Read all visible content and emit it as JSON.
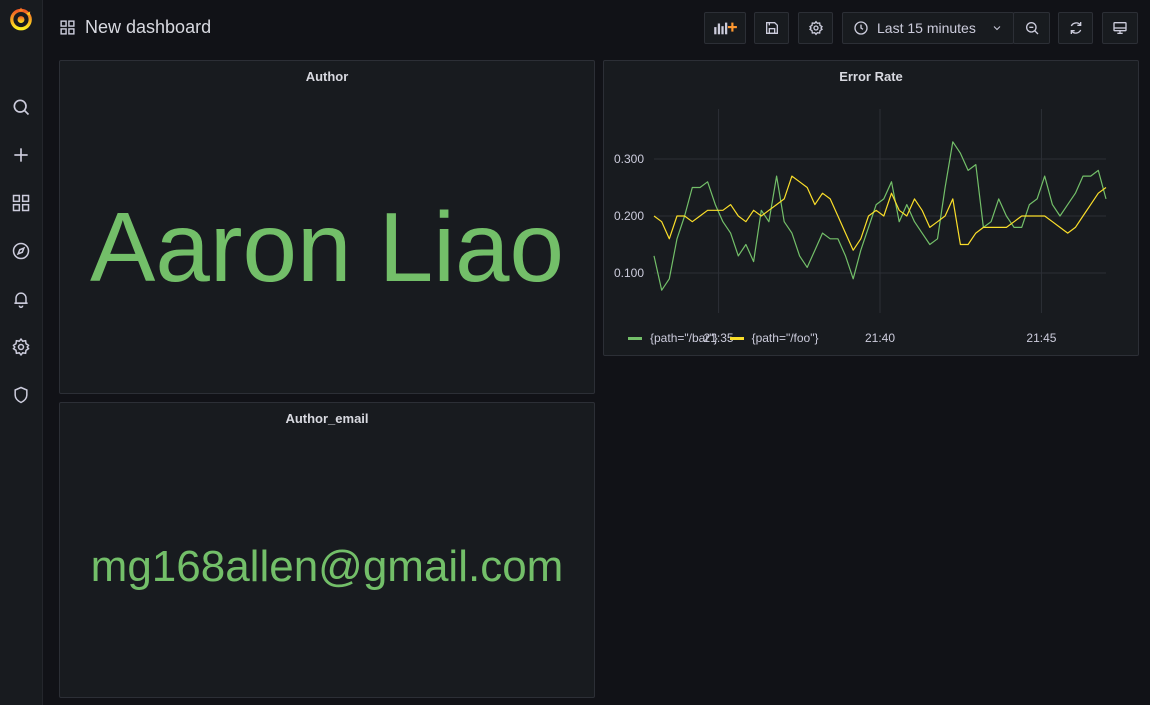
{
  "header": {
    "title": "New dashboard",
    "time_range": "Last 15 minutes"
  },
  "sidebar": {
    "icons": [
      "grafana-logo-icon",
      "search-icon",
      "plus-icon",
      "dashboards-icon",
      "explore-icon",
      "alert-bell-icon",
      "settings-gear-icon",
      "shield-icon"
    ]
  },
  "panels": {
    "author": {
      "title": "Author",
      "value": "Aaron Liao"
    },
    "author_email": {
      "title": "Author_email",
      "value": "mg168allen@gmail.com"
    },
    "error_rate": {
      "title": "Error Rate"
    }
  },
  "colors": {
    "stat": "#73bf69",
    "bar": "#73bf69",
    "foo": "#fade2a",
    "accent": "#f55f3e"
  },
  "chart_data": {
    "type": "line",
    "title": "Error Rate",
    "xlabel": "",
    "ylabel": "",
    "x_ticks": [
      "21:35",
      "21:40",
      "21:45"
    ],
    "y_ticks": [
      "0.100",
      "0.200",
      "0.300"
    ],
    "ylim": [
      0.03,
      0.37
    ],
    "x_range_minutes": [
      21.3,
      22.7
    ],
    "grid": true,
    "legend_position": "bottom-left",
    "series": [
      {
        "name": "{path=\"/bar\"}",
        "color": "#73bf69",
        "values": [
          0.13,
          0.07,
          0.09,
          0.16,
          0.2,
          0.25,
          0.25,
          0.26,
          0.22,
          0.19,
          0.17,
          0.13,
          0.15,
          0.12,
          0.21,
          0.19,
          0.27,
          0.19,
          0.17,
          0.13,
          0.11,
          0.14,
          0.17,
          0.16,
          0.16,
          0.13,
          0.09,
          0.14,
          0.18,
          0.22,
          0.23,
          0.26,
          0.19,
          0.22,
          0.19,
          0.17,
          0.15,
          0.16,
          0.25,
          0.33,
          0.31,
          0.28,
          0.29,
          0.18,
          0.19,
          0.23,
          0.2,
          0.18,
          0.18,
          0.22,
          0.23,
          0.27,
          0.22,
          0.2,
          0.22,
          0.24,
          0.27,
          0.27,
          0.28,
          0.23
        ]
      },
      {
        "name": "{path=\"/foo\"}",
        "color": "#fade2a",
        "values": [
          0.2,
          0.19,
          0.16,
          0.2,
          0.2,
          0.19,
          0.2,
          0.21,
          0.21,
          0.21,
          0.22,
          0.2,
          0.19,
          0.21,
          0.2,
          0.21,
          0.22,
          0.23,
          0.27,
          0.26,
          0.25,
          0.22,
          0.24,
          0.23,
          0.2,
          0.17,
          0.14,
          0.16,
          0.2,
          0.21,
          0.2,
          0.24,
          0.21,
          0.2,
          0.23,
          0.21,
          0.18,
          0.19,
          0.2,
          0.23,
          0.15,
          0.15,
          0.17,
          0.18,
          0.18,
          0.18,
          0.18,
          0.19,
          0.2,
          0.2,
          0.2,
          0.2,
          0.19,
          0.18,
          0.17,
          0.18,
          0.2,
          0.22,
          0.24,
          0.25
        ]
      }
    ]
  }
}
